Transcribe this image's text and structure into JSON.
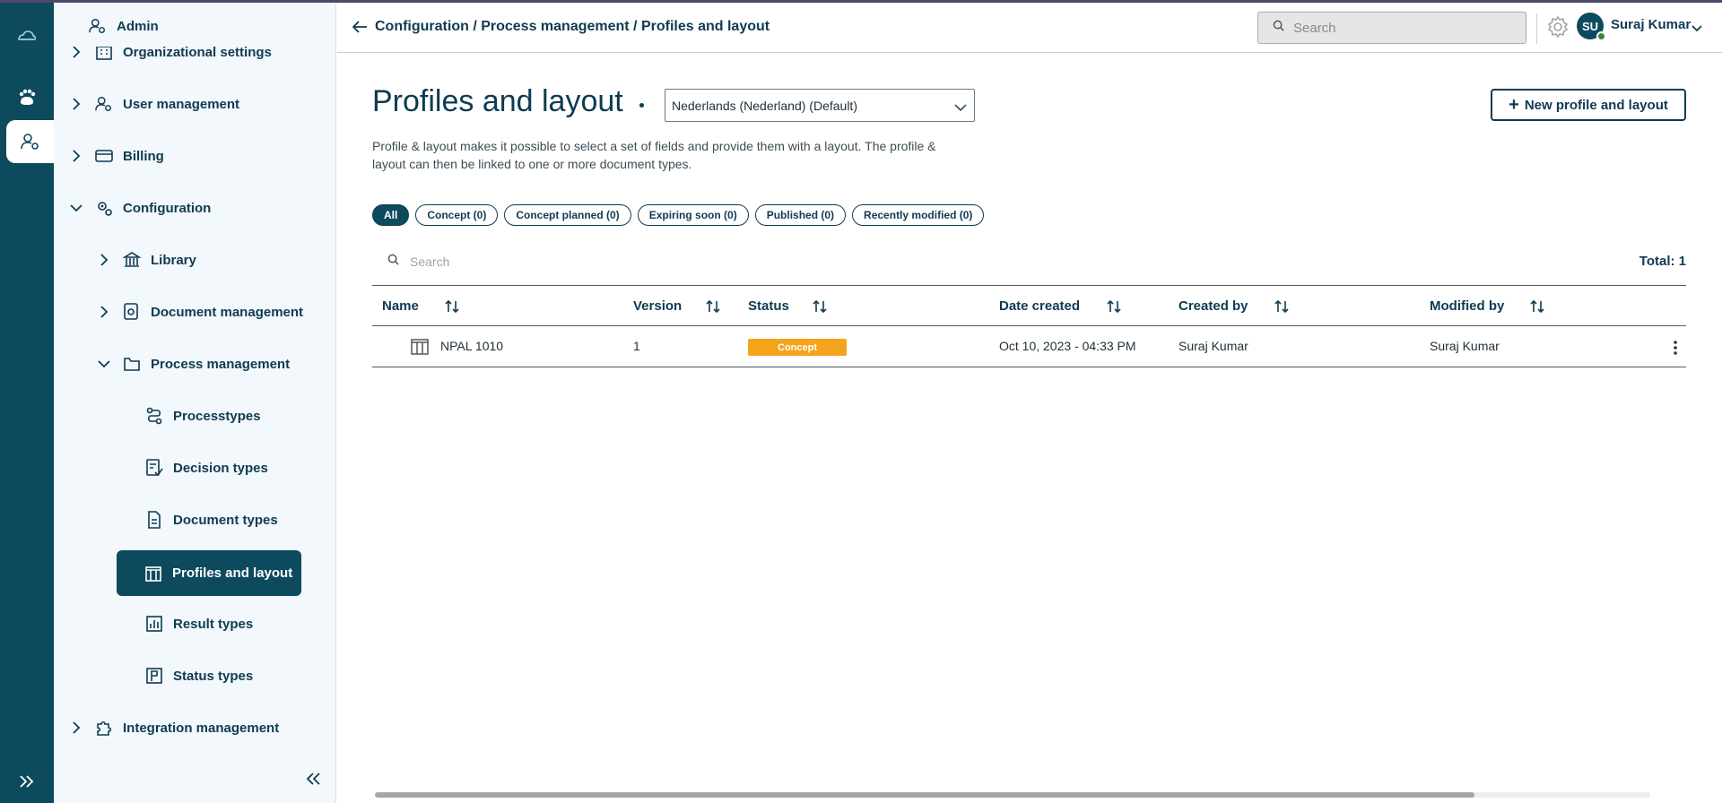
{
  "colors": {
    "primary": "#0d4a5e",
    "accent_concept": "#f3a41b",
    "online": "#2f8a2f"
  },
  "rail": {
    "items": [
      "cloud-logo-icon",
      "paw-icon",
      "user-gear-icon"
    ],
    "expand_icon": "double-chevron-right-icon"
  },
  "sidebar": {
    "admin": "Admin",
    "org_settings": "Organizational settings",
    "user_management": "User management",
    "billing": "Billing",
    "configuration": "Configuration",
    "library": "Library",
    "document_management": "Document management",
    "process_management": "Process management",
    "processtypes": "Processtypes",
    "decision_types": "Decision types",
    "document_types": "Document types",
    "profiles_layout": "Profiles and layout",
    "result_types": "Result types",
    "status_types": "Status types",
    "integration_management": "Integration management"
  },
  "header": {
    "breadcrumb": "Configuration / Process management / Profiles and layout",
    "search_placeholder": "Search",
    "avatar_initials": "SU",
    "user_name": "Suraj Kumar"
  },
  "main": {
    "title": "Profiles and layout",
    "language": "Nederlands (Nederland) (Default)",
    "new_button": "New profile and layout",
    "description": "Profile & layout makes it possible to select a set of fields and provide them with a layout. The profile & layout can then be linked to one or more document types.",
    "filters": [
      "All",
      "Concept (0)",
      "Concept planned (0)",
      "Expiring soon (0)",
      "Published (0)",
      "Recently modified (0)"
    ],
    "table_search_placeholder": "Search",
    "total": "Total: 1"
  },
  "table": {
    "columns": [
      "Name",
      "Version",
      "Status",
      "Date created",
      "Created by",
      "Modified by"
    ],
    "rows": [
      {
        "name": "NPAL 1010",
        "version": "1",
        "status": "Concept",
        "date_created": "Oct 10, 2023 - 04:33 PM",
        "created_by": "Suraj  Kumar",
        "modified_by": "Suraj  Kumar"
      }
    ]
  }
}
